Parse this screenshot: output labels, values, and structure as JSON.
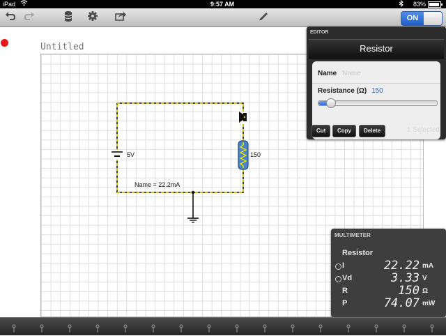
{
  "status_bar": {
    "device": "iPad",
    "time": "9:57 AM",
    "battery": "83%",
    "wifi_icon": "wifi-icon",
    "bluetooth_icon": "bluetooth-icon",
    "battery_icon": "battery-icon"
  },
  "toolbar": {
    "icons": [
      "undo-icon",
      "redo-icon",
      "database-icon",
      "gear-icon",
      "share-icon",
      "pencil-icon"
    ],
    "toggle_label": "ON",
    "toggle_on": true,
    "toggle_color": "#1f5fc8"
  },
  "document": {
    "title": "Untitled",
    "record_indicator_color": "#e21a1a"
  },
  "circuit": {
    "wire_color": "#e8d400",
    "battery_label": "5V",
    "resistor_label": "150",
    "wire_annotation": "Name = 22.2mA"
  },
  "editor": {
    "caption": "EDITOR",
    "title": "Resistor",
    "name_label": "Name",
    "name_placeholder": "Name",
    "resistance_label": "Resistance (Ω)",
    "resistance_value": "150",
    "slider_fraction": 0.1,
    "cut_label": "Cut",
    "copy_label": "Copy",
    "delete_label": "Delete",
    "selection_status": "1 Selected"
  },
  "multimeter": {
    "caption": "MULTIMETER",
    "title": "Resistor",
    "rows": [
      {
        "label": "I",
        "value": "22.22",
        "unit": "mA",
        "radio": true
      },
      {
        "label": "Vd",
        "value": "3.33",
        "unit": "V",
        "radio": true
      },
      {
        "label": "R",
        "value": "150",
        "unit": "Ω",
        "radio": false
      },
      {
        "label": "P",
        "value": "74.07",
        "unit": "mW",
        "radio": false
      }
    ]
  },
  "component_bar": {
    "icons": [
      "wire-icon",
      "battery-component-icon",
      "resistor-component-icon",
      "switch-component-icon",
      "ground-component-icon",
      "speaker-component-icon",
      "led-component-icon",
      "capacitor-component-icon",
      "inductor-component-icon",
      "probe-component-icon",
      "lamp-component-icon",
      "diode-component-icon",
      "meter-component-icon",
      "connector-component-icon",
      "fuse-component-icon",
      "toggle-component-icon"
    ]
  }
}
